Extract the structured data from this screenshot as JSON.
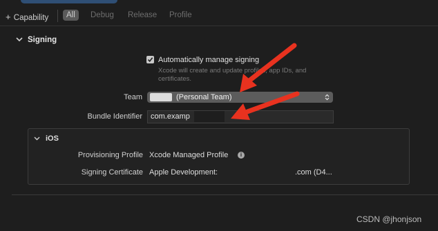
{
  "toolbar": {
    "add_capability": "Capability",
    "filters": [
      "All",
      "Debug",
      "Release",
      "Profile"
    ]
  },
  "signing": {
    "title": "Signing",
    "auto_manage_label": "Automatically manage signing",
    "auto_manage_checked": true,
    "auto_manage_description": "Xcode will create and update profiles, app IDs, and certificates.",
    "team_label": "Team",
    "team_value": "(Personal Team)",
    "bundle_label": "Bundle Identifier",
    "bundle_value": "com.examp"
  },
  "ios": {
    "title": "iOS",
    "provisioning_label": "Provisioning Profile",
    "provisioning_value": "Xcode Managed Profile",
    "certificate_label": "Signing Certificate",
    "certificate_value": "Apple Development: ",
    "certificate_suffix": ".com (D4..."
  },
  "watermark": "CSDN @jhonjson",
  "colors": {
    "background": "#1e1e1e",
    "annotation_arrow": "#e8321f",
    "selected_filter": "#5a5a5a"
  }
}
